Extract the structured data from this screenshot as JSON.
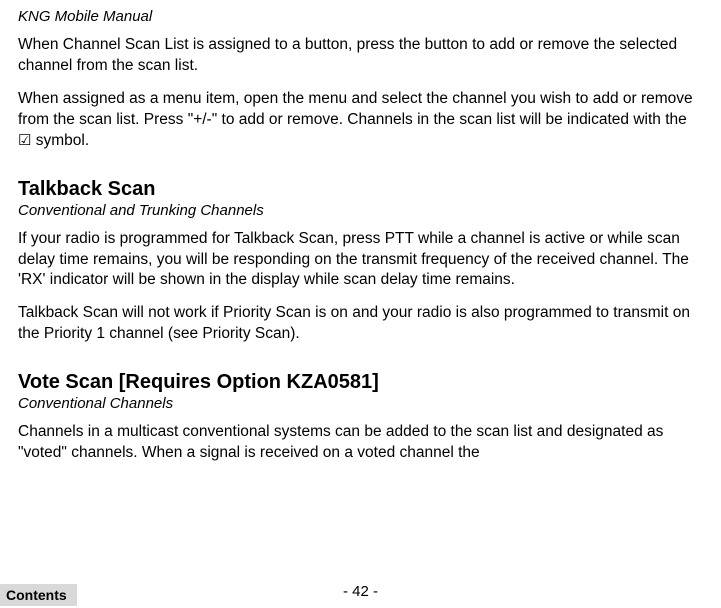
{
  "running_header": "KNG Mobile Manual",
  "intro_para_1": "When Channel Scan List is assigned to a button, press the button to add or remove the selected channel from the scan list.",
  "intro_para_2_pre": "When assigned as a menu item, open the menu and select the channel you wish to add or remove from the scan list. Press \"+/-\" to add or remove. Channels in the scan list will be indicated with the ",
  "checkbox_symbol": "☑",
  "intro_para_2_post": " symbol.",
  "section_1": {
    "title": "Talkback Scan",
    "subtitle": "Conventional and Trunking Channels",
    "para_1": "If your radio is programmed for Talkback Scan, press PTT while a channel is active or while scan delay time remains, you will be responding on the transmit frequency of the received channel. The 'RX' indicator will be shown in the display while scan delay time remains.",
    "para_2": "Talkback Scan will not work if Priority Scan is on and your radio is also programmed to transmit on the Priority 1 channel (see Priority Scan)."
  },
  "section_2": {
    "title": "Vote Scan [Requires Option KZA0581]",
    "subtitle": "Conventional Channels",
    "para_1": "Channels in a multicast conventional systems can be added to the scan list and designated as \"voted\" channels. When a signal is received on a voted channel the"
  },
  "page_number": "- 42 -",
  "contents_button": "Contents"
}
